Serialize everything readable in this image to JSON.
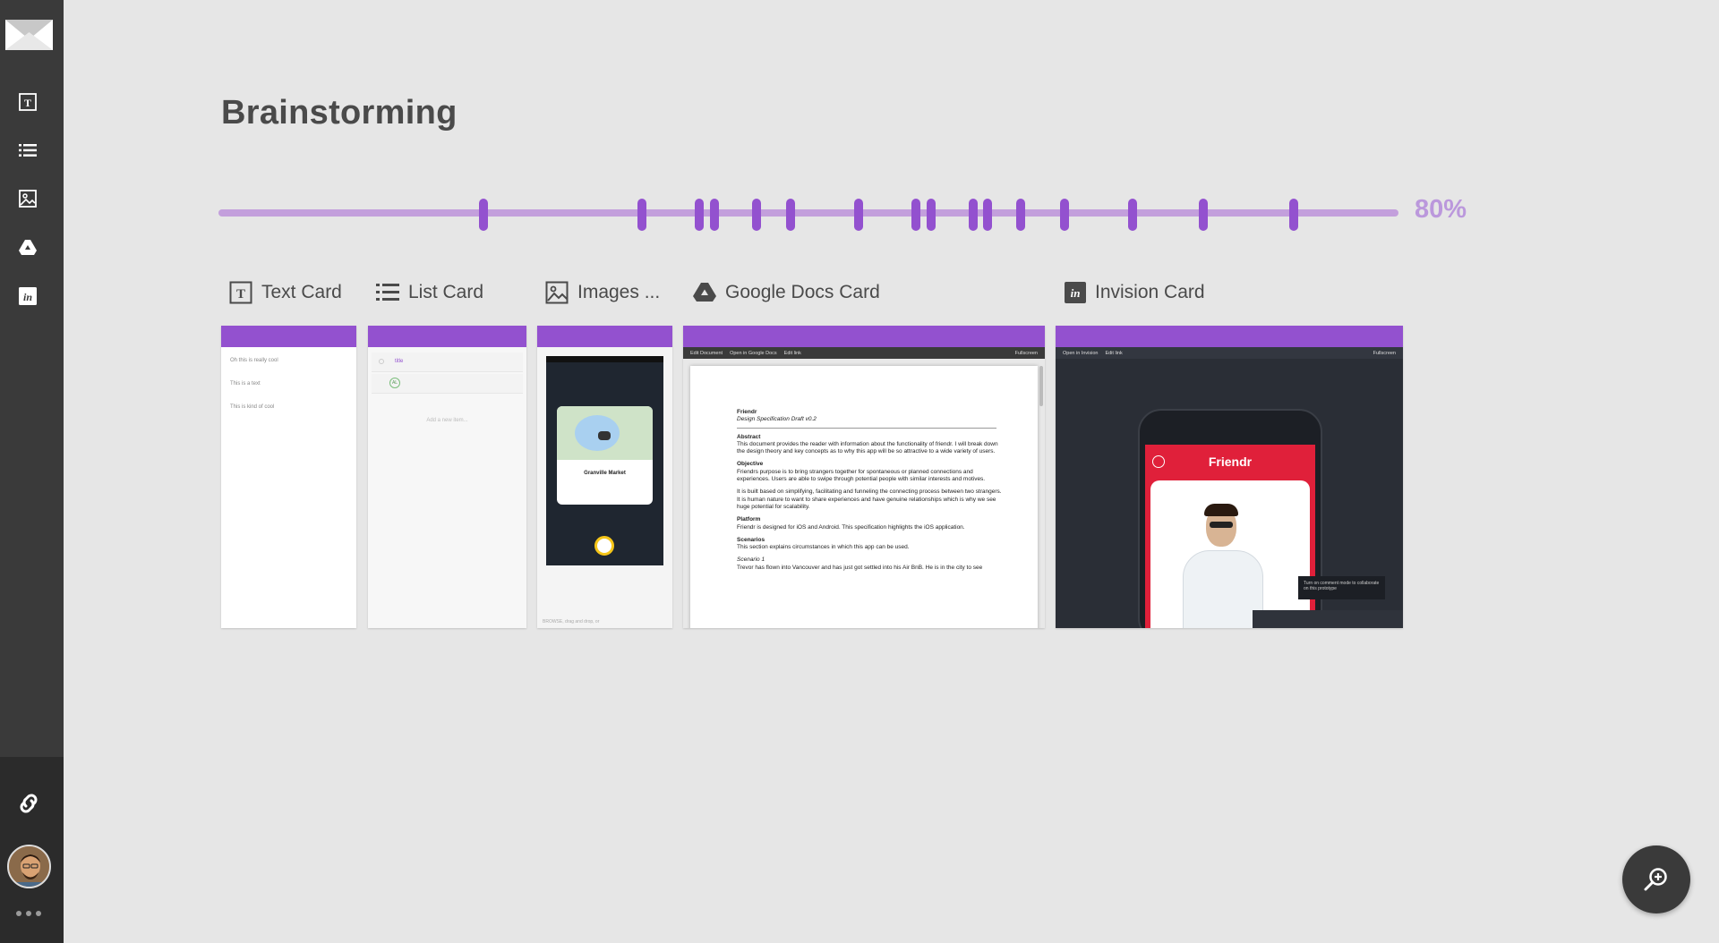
{
  "page": {
    "title": "Brainstorming"
  },
  "sidebar": {
    "items": [
      {
        "name": "text-card-tool",
        "icon": "text-card-icon"
      },
      {
        "name": "list-card-tool",
        "icon": "list-icon"
      },
      {
        "name": "image-card-tool",
        "icon": "image-icon"
      },
      {
        "name": "google-docs-tool",
        "icon": "google-drive-icon"
      },
      {
        "name": "invision-tool",
        "icon": "invision-icon"
      }
    ]
  },
  "progress": {
    "label": "80%",
    "value": 0.8
  },
  "cards": [
    {
      "label": "Text Card",
      "icon": "text-card-icon"
    },
    {
      "label": "List Card",
      "icon": "list-icon"
    },
    {
      "label": "Images ...",
      "icon": "image-icon"
    },
    {
      "label": "Google Docs Card",
      "icon": "google-drive-icon"
    },
    {
      "label": "Invision Card",
      "icon": "invision-icon"
    }
  ],
  "text_card": {
    "lines": [
      "Oh this is really cool",
      "This is a text",
      "This is kind of cool"
    ]
  },
  "list_card": {
    "item_1": "title",
    "item_2_initials": "AL",
    "add_placeholder": "Add a new item..."
  },
  "image_card": {
    "place_label": "Granville Market",
    "footer": "BROWSE, drag and drop, or"
  },
  "gdocs_card": {
    "toolbar": [
      "Edit Document",
      "Open in Google Docs",
      "Edit link"
    ],
    "fullscreen": "Fullscreen",
    "doc_title": "Friendr",
    "doc_subtitle": "Design Specification Draft v0.2",
    "sections": [
      {
        "heading": "Abstract",
        "body": "This document provides the reader with information about the functionality of friendr. I will break down the design theory and key concepts as to why this app will be so attractive to a wide variety of users."
      },
      {
        "heading": "Objective",
        "body": "Friendrs purpose is to bring strangers together for spontaneous or planned connections and experiences. Users are able to swipe through potential people with similar interests and motives."
      },
      {
        "heading": "",
        "body": "It is built based on simplifying, facilitating and funneling the connecting process between two strangers. It is human nature to want to share experiences and have genuine relationships which is why we see huge potential for scalability."
      },
      {
        "heading": "Platform",
        "body": "Friendr is designed for iOS and Android. This specification highlights the iOS application."
      },
      {
        "heading": "Scenarios",
        "body": "This section explains circumstances in which this app can be used."
      },
      {
        "heading": "Scenario 1",
        "body": "Trevor has flown into Vancouver and has just got settled into his Air BnB. He is in the city to see"
      }
    ]
  },
  "invision_card": {
    "toolbar": [
      "Open in Invision",
      "Edit link"
    ],
    "fullscreen": "Fullscreen",
    "app_title": "Friendr",
    "tooltip": "Turn on comment mode to collaborate on this prototype"
  },
  "colors": {
    "accent": "#9351cf",
    "track": "#c39fdc",
    "sidebar": "#3a3a3a",
    "background": "#e6e6e6",
    "invision_red": "#e0203a"
  }
}
